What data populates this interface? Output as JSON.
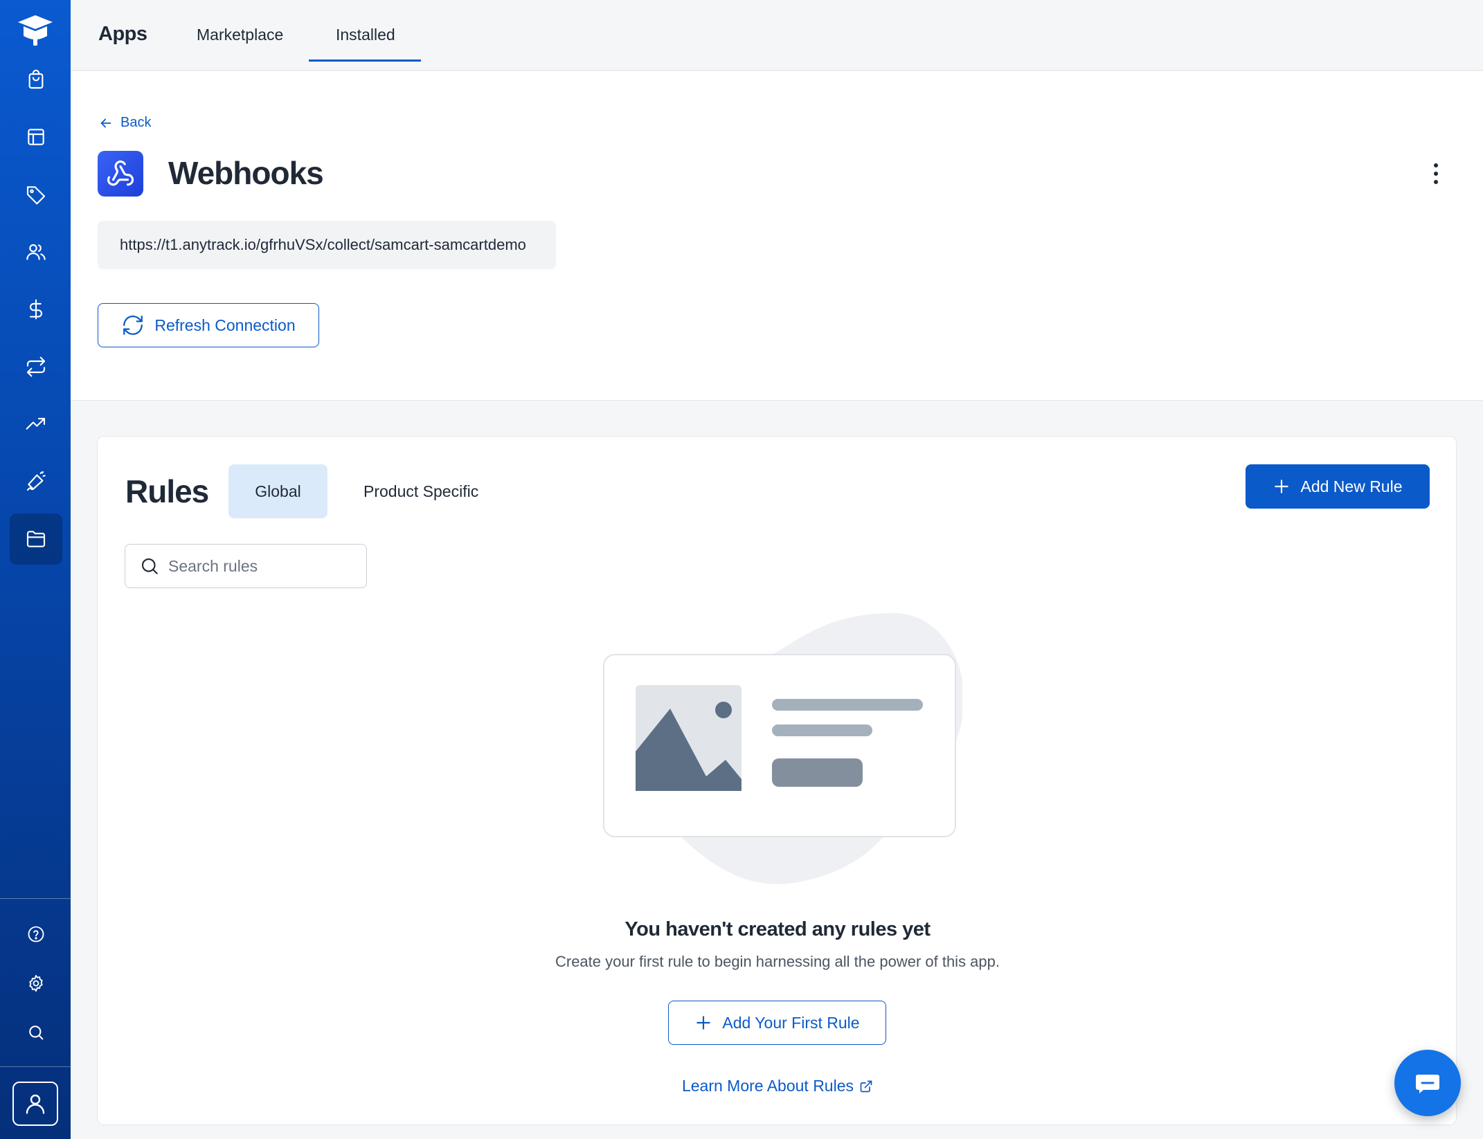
{
  "topbar": {
    "title": "Apps",
    "tabs": [
      {
        "label": "Marketplace"
      },
      {
        "label": "Installed",
        "active": true
      }
    ]
  },
  "sidebar": {
    "items": [
      {
        "icon": "shopping-bag-icon"
      },
      {
        "icon": "layout-icon"
      },
      {
        "icon": "tag-icon"
      },
      {
        "icon": "users-icon"
      },
      {
        "icon": "dollar-icon"
      },
      {
        "icon": "repeat-icon"
      },
      {
        "icon": "trending-up-icon"
      },
      {
        "icon": "megaphone-icon"
      },
      {
        "icon": "folder-icon",
        "active": true
      }
    ],
    "bottom": [
      {
        "icon": "help-icon"
      },
      {
        "icon": "gear-icon"
      },
      {
        "icon": "search-icon"
      }
    ]
  },
  "header": {
    "back_label": "Back",
    "title": "Webhooks",
    "url": "https://t1.anytrack.io/gfrhuVSx/collect/samcart-samcartdemo",
    "refresh_label": "Refresh Connection"
  },
  "rules": {
    "title": "Rules",
    "segments": [
      {
        "label": "Global",
        "active": true
      },
      {
        "label": "Product Specific"
      }
    ],
    "add_label": "Add New Rule",
    "search_placeholder": "Search rules",
    "empty_title": "You haven't created any rules yet",
    "empty_subtitle": "Create your first rule to begin harnessing all the power of this app.",
    "first_rule_label": "Add Your First Rule",
    "learn_more_label": "Learn More About Rules"
  },
  "colors": {
    "primary": "#0b5ac9",
    "sidebar_top": "#0a5ad0",
    "sidebar_bottom": "#052f7a",
    "segment_active_bg": "#dbeafb"
  }
}
